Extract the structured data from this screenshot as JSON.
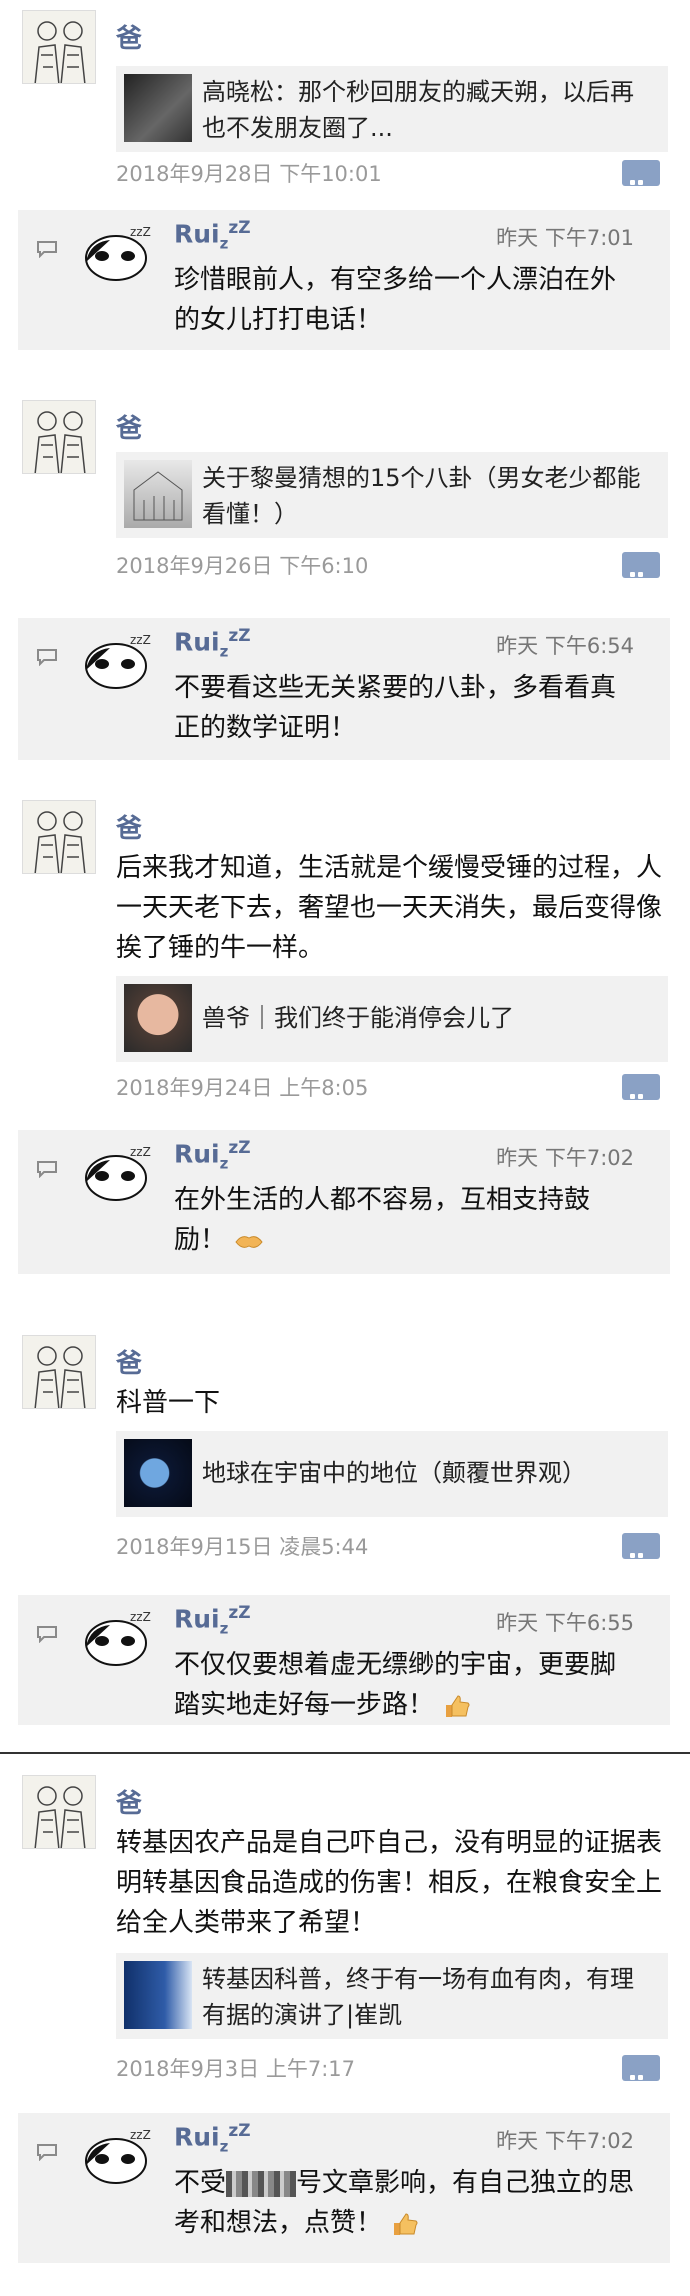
{
  "dad": {
    "name": "爸"
  },
  "reply_user": {
    "name": "Rui",
    "zzz": "zzZ"
  },
  "posts": [
    {
      "link": {
        "title": "高晓松：那个秒回朋友的臧天朔，以后再也不发朋友圈了..."
      },
      "timestamp": "2018年9月28日 下午10:01",
      "reply": {
        "time": "昨天 下午7:01",
        "text": "珍惜眼前人，有空多给一个人漂泊在外的女儿打打电话！"
      }
    },
    {
      "link": {
        "title": "关于黎曼猜想的15个八卦（男女老少都能看懂！）"
      },
      "timestamp": "2018年9月26日 下午6:10",
      "reply": {
        "time": "昨天 下午6:54",
        "text": "不要看这些无关紧要的八卦，多看看真正的数学证明！"
      }
    },
    {
      "text": "后来我才知道，生活就是个缓慢受锤的过程，人一天天老下去，奢望也一天天消失，最后变得像挨了锤的牛一样。",
      "link": {
        "title": "兽爷｜我们终于能消停会儿了"
      },
      "timestamp": "2018年9月24日 上午8:05",
      "reply": {
        "time": "昨天 下午7:02",
        "text": "在外生活的人都不容易，互相支持鼓励！"
      }
    },
    {
      "text": "科普一下",
      "link": {
        "title": "地球在宇宙中的地位（颠覆世界观）"
      },
      "timestamp": "2018年9月15日 凌晨5:44",
      "reply": {
        "time": "昨天 下午6:55",
        "text": "不仅仅要想着虚无缥缈的宇宙，更要脚踏实地走好每一步路！"
      }
    },
    {
      "text": "转基因农产品是自己吓自己，没有明显的证据表明转基因食品造成的伤害！相反，在粮食安全上给全人类带来了希望！",
      "link": {
        "title": "转基因科普，终于有一场有血有肉，有理有据的演讲了|崔凯"
      },
      "timestamp": "2018年9月3日 上午7:17",
      "reply": {
        "time": "昨天 下午7:02",
        "text_before": "不受",
        "text_after": "号文章影响，有自己独立的思考和想法，点赞！"
      }
    }
  ],
  "icons": {
    "comment": "comment-dots-icon",
    "reply": "speech-bubble-icon",
    "handshake": "handshake-emoji",
    "thumbs_up": "thumbs-up-emoji"
  },
  "colors": {
    "name": "#576b95",
    "comment_button": "#8aa1c5",
    "card_bg": "#f1f1f1",
    "timestamp": "#9a9a9a"
  }
}
